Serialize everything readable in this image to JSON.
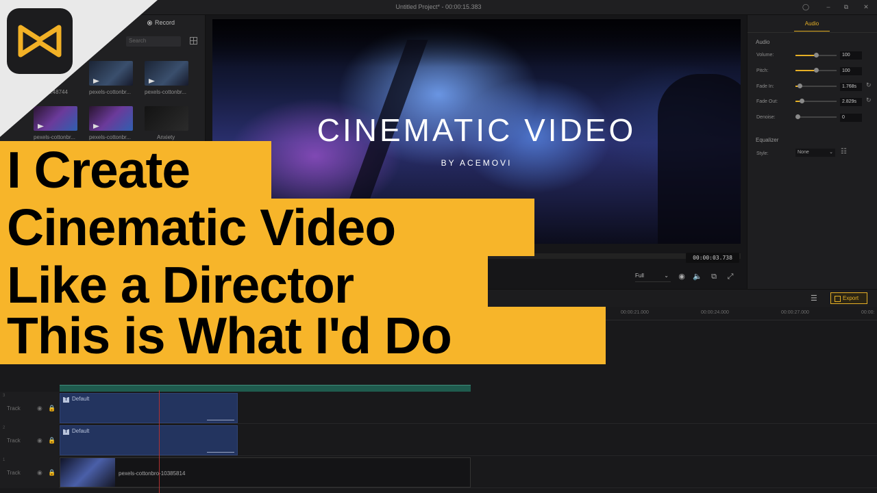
{
  "window": {
    "title": "Untitled Project* - 00:00:15.383"
  },
  "media_panel": {
    "record_label": "Record",
    "search_placeholder": "Search",
    "items": [
      {
        "label": "...48744"
      },
      {
        "label": "pexels-cottonbr..."
      },
      {
        "label": "pexels-cottonbr..."
      },
      {
        "label": "pexels-cottonbr..."
      },
      {
        "label": "pexels-cottonbr..."
      },
      {
        "label": "Anxiety"
      }
    ]
  },
  "preview": {
    "overlay_title": "CINEMATIC VIDEO",
    "overlay_subtitle": "BY ACEMOVI",
    "timecode": "00:00:03.738",
    "zoom_option": "Full"
  },
  "audio_panel": {
    "tab_label": "Audio",
    "section_audio": "Audio",
    "rows": [
      {
        "label": "Volume:",
        "value": "100",
        "level": 0.5
      },
      {
        "label": "Pitch:",
        "value": "100",
        "level": 0.5
      },
      {
        "label": "Fade In:",
        "value": "1.768s",
        "level": 0.1
      },
      {
        "label": "Fade Out:",
        "value": "2.829s",
        "level": 0.15
      },
      {
        "label": "Denoise:",
        "value": "0",
        "level": 0
      }
    ],
    "section_equalizer": "Equalizer",
    "style_label": "Style:",
    "style_value": "None"
  },
  "timeline": {
    "export_label": "Export",
    "ruler_ticks": [
      "00:00:21.000",
      "00:00:24.000",
      "00:00:27.000",
      "00:00:"
    ],
    "tracks": [
      {
        "num": "3",
        "name": "Track",
        "clip_type": "text",
        "clip_label": "Default"
      },
      {
        "num": "2",
        "name": "Track",
        "clip_type": "text",
        "clip_label": "Default"
      },
      {
        "num": "1",
        "name": "Track",
        "clip_type": "video",
        "clip_label": "pexels-cottonbro-10385814"
      }
    ]
  },
  "overlay_banner": {
    "lines": [
      "I Create",
      "Cinematic Video",
      "Like a Director",
      "This is What I'd Do"
    ],
    "color": "#f7b52a"
  },
  "colors": {
    "accent": "#e6b026",
    "background": "#1b1b1d",
    "text_clip": "#23345f"
  }
}
